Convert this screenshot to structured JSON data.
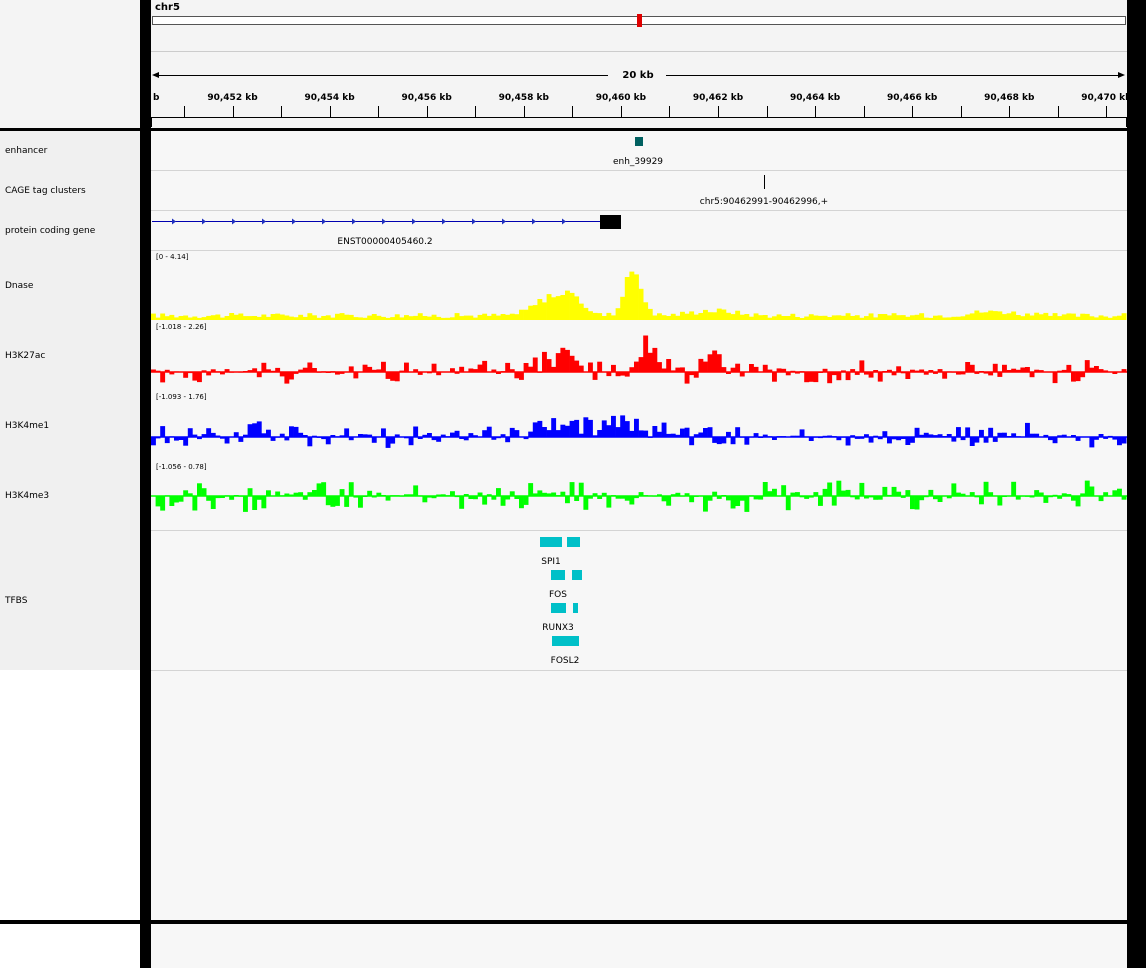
{
  "header": {
    "chromosome": "chr5",
    "span_label": "20 kb",
    "cytoband_marker_color": "#e00000"
  },
  "ruler": {
    "left_partial_label": "b",
    "ticks": [
      {
        "kb": 90452,
        "label": "90,452 kb"
      },
      {
        "kb": 90454,
        "label": "90,454 kb"
      },
      {
        "kb": 90456,
        "label": "90,456 kb"
      },
      {
        "kb": 90458,
        "label": "90,458 kb"
      },
      {
        "kb": 90460,
        "label": "90,460 kb"
      },
      {
        "kb": 90462,
        "label": "90,462 kb"
      },
      {
        "kb": 90464,
        "label": "90,464 kb"
      },
      {
        "kb": 90466,
        "label": "90,466 kb"
      },
      {
        "kb": 90468,
        "label": "90,468 kb"
      },
      {
        "kb": 90470,
        "label": "90,470 kb"
      }
    ]
  },
  "tracks": {
    "enhancer": {
      "name": "enhancer",
      "feature_label": "enh_39929",
      "color": "#006060"
    },
    "cage": {
      "name": "CAGE tag clusters",
      "feature_label": "chr5:90462991-90462996,+"
    },
    "gene": {
      "name": "protein coding gene",
      "feature_label": "ENST00000405460.2",
      "color": "#0000b0"
    },
    "dnase": {
      "name": "Dnase",
      "range": "[0 - 4.14]",
      "color": "#ffff00",
      "min": 0,
      "max": 4.14
    },
    "h3k27ac": {
      "name": "H3K27ac",
      "range": "[-1.018 - 2.26]",
      "color": "#ff0000",
      "min": -1.018,
      "max": 2.26
    },
    "h3k4me1": {
      "name": "H3K4me1",
      "range": "[-1.093 - 1.76]",
      "color": "#0000ff",
      "min": -1.093,
      "max": 1.76
    },
    "h3k4me3": {
      "name": "H3K4me3",
      "range": "[-1.056 - 0.78]",
      "color": "#00ff00",
      "min": -1.056,
      "max": 0.78
    },
    "tfbs": {
      "name": "TFBS",
      "color": "#00c0c8",
      "items": [
        {
          "label": "SPI1"
        },
        {
          "label": "FOS"
        },
        {
          "label": "RUNX3"
        },
        {
          "label": "FOSL2"
        }
      ]
    }
  }
}
